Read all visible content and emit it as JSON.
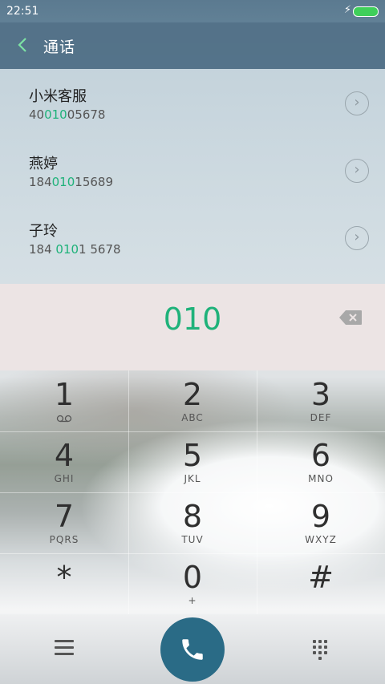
{
  "status_bar": {
    "time": "22:51",
    "charging_icon": "bolt-icon",
    "battery_icon": "battery-icon"
  },
  "header": {
    "title": "通话",
    "back_icon": "back-arrow-icon"
  },
  "search_results": [
    {
      "name": "小米客服",
      "number_prefix": "40",
      "number_match": "010",
      "number_suffix": "05678"
    },
    {
      "name": "燕婷",
      "number_prefix": "184",
      "number_match": "010",
      "number_suffix": "15689"
    },
    {
      "name": "子玲",
      "number_prefix": "184 ",
      "number_match": "010",
      "number_suffix": "1 5678"
    }
  ],
  "dial_input": {
    "value": "010",
    "backspace_icon": "backspace-icon"
  },
  "keypad": [
    {
      "digit": "1",
      "letters": ""
    },
    {
      "digit": "2",
      "letters": "ABC"
    },
    {
      "digit": "3",
      "letters": "DEF"
    },
    {
      "digit": "4",
      "letters": "GHI"
    },
    {
      "digit": "5",
      "letters": "JKL"
    },
    {
      "digit": "6",
      "letters": "MNO"
    },
    {
      "digit": "7",
      "letters": "PQRS"
    },
    {
      "digit": "8",
      "letters": "TUV"
    },
    {
      "digit": "9",
      "letters": "WXYZ"
    },
    {
      "digit": "*",
      "letters": ""
    },
    {
      "digit": "0",
      "letters": "+"
    },
    {
      "digit": "#",
      "letters": ""
    }
  ],
  "bottom_bar": {
    "menu_icon": "menu-icon",
    "call_icon": "phone-icon",
    "keypad_icon": "dialpad-icon"
  },
  "colors": {
    "accent": "#1fb27a",
    "call_button": "#2a6b86",
    "header": "#52718a"
  }
}
